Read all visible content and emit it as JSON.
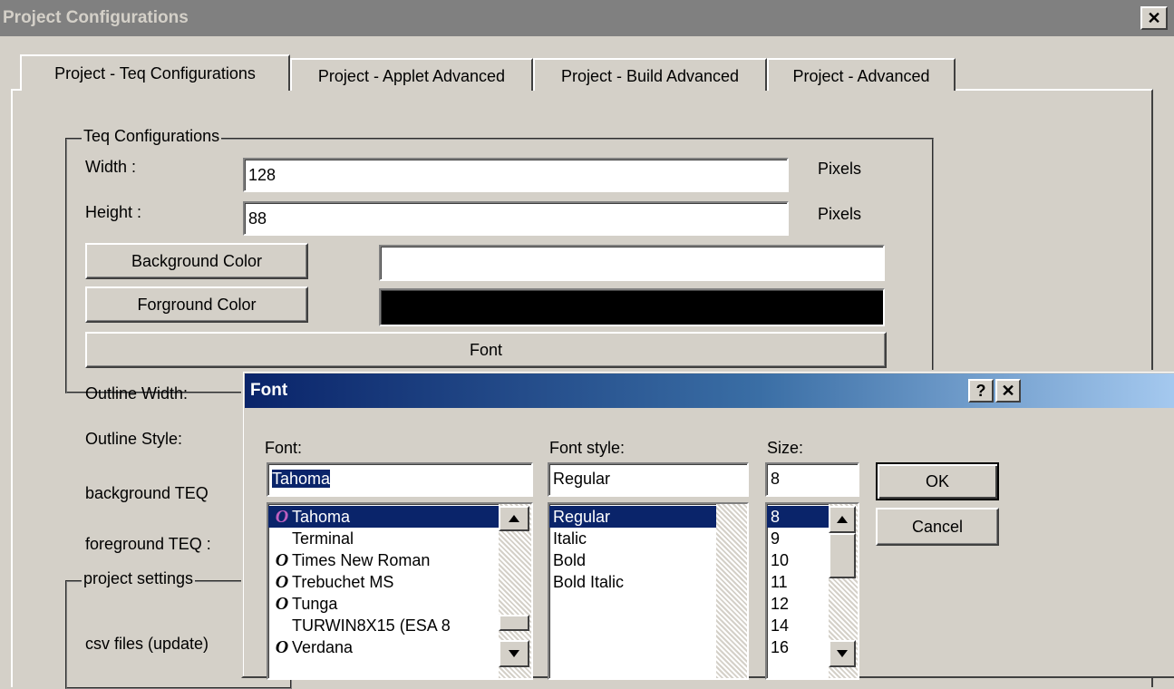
{
  "window": {
    "title": "Project Configurations",
    "close_glyph": "✕"
  },
  "tabs": [
    {
      "label": "Project - Teq Configurations",
      "active": true
    },
    {
      "label": "Project - Applet Advanced",
      "active": false
    },
    {
      "label": "Project - Build Advanced",
      "active": false
    },
    {
      "label": "Project - Advanced",
      "active": false
    }
  ],
  "teq": {
    "group_label": "Teq Configurations",
    "width_label": "Width :",
    "width_value": "128",
    "width_unit": "Pixels",
    "height_label": "Height :",
    "height_value": "88",
    "height_unit": "Pixels",
    "bg_button": "Background Color",
    "bg_swatch": "#ffffff",
    "fg_button": "Forground Color",
    "fg_swatch": "#000000",
    "font_button": "Font",
    "outline_width_label": "Outline Width:",
    "outline_style_label": "Outline Style:",
    "bg_teq_label": "background TEQ",
    "fg_teq_label": "foreground TEQ :"
  },
  "project_settings": {
    "group_label": "project settings",
    "csv_label": "csv files (update)"
  },
  "font_dialog": {
    "title": "Font",
    "help_glyph": "?",
    "close_glyph": "✕",
    "font_label": "Font:",
    "font_value": "Tahoma",
    "style_label": "Font style:",
    "style_value": "Regular",
    "size_label": "Size:",
    "size_value": "8",
    "ok": "OK",
    "cancel": "Cancel",
    "fonts": [
      {
        "name": "Tahoma",
        "icon": "opentype-icon",
        "glyph": "O",
        "selected": true
      },
      {
        "name": "Terminal",
        "icon": "none",
        "glyph": "",
        "selected": false
      },
      {
        "name": "Times New Roman",
        "icon": "opentype-icon",
        "glyph": "O",
        "selected": false
      },
      {
        "name": "Trebuchet MS",
        "icon": "opentype-icon",
        "glyph": "O",
        "selected": false
      },
      {
        "name": "Tunga",
        "icon": "opentype-icon",
        "glyph": "O",
        "selected": false
      },
      {
        "name": "TURWIN8X15 (ESA 8",
        "icon": "none",
        "glyph": "",
        "selected": false
      },
      {
        "name": "Verdana",
        "icon": "opentype-icon",
        "glyph": "O",
        "selected": false
      }
    ],
    "styles": [
      {
        "name": "Regular",
        "selected": true
      },
      {
        "name": "Italic",
        "selected": false
      },
      {
        "name": "Bold",
        "selected": false
      },
      {
        "name": "Bold Italic",
        "selected": false
      }
    ],
    "sizes": [
      {
        "name": "8",
        "selected": true
      },
      {
        "name": "9",
        "selected": false
      },
      {
        "name": "10",
        "selected": false
      },
      {
        "name": "11",
        "selected": false
      },
      {
        "name": "12",
        "selected": false
      },
      {
        "name": "14",
        "selected": false
      },
      {
        "name": "16",
        "selected": false
      }
    ]
  }
}
